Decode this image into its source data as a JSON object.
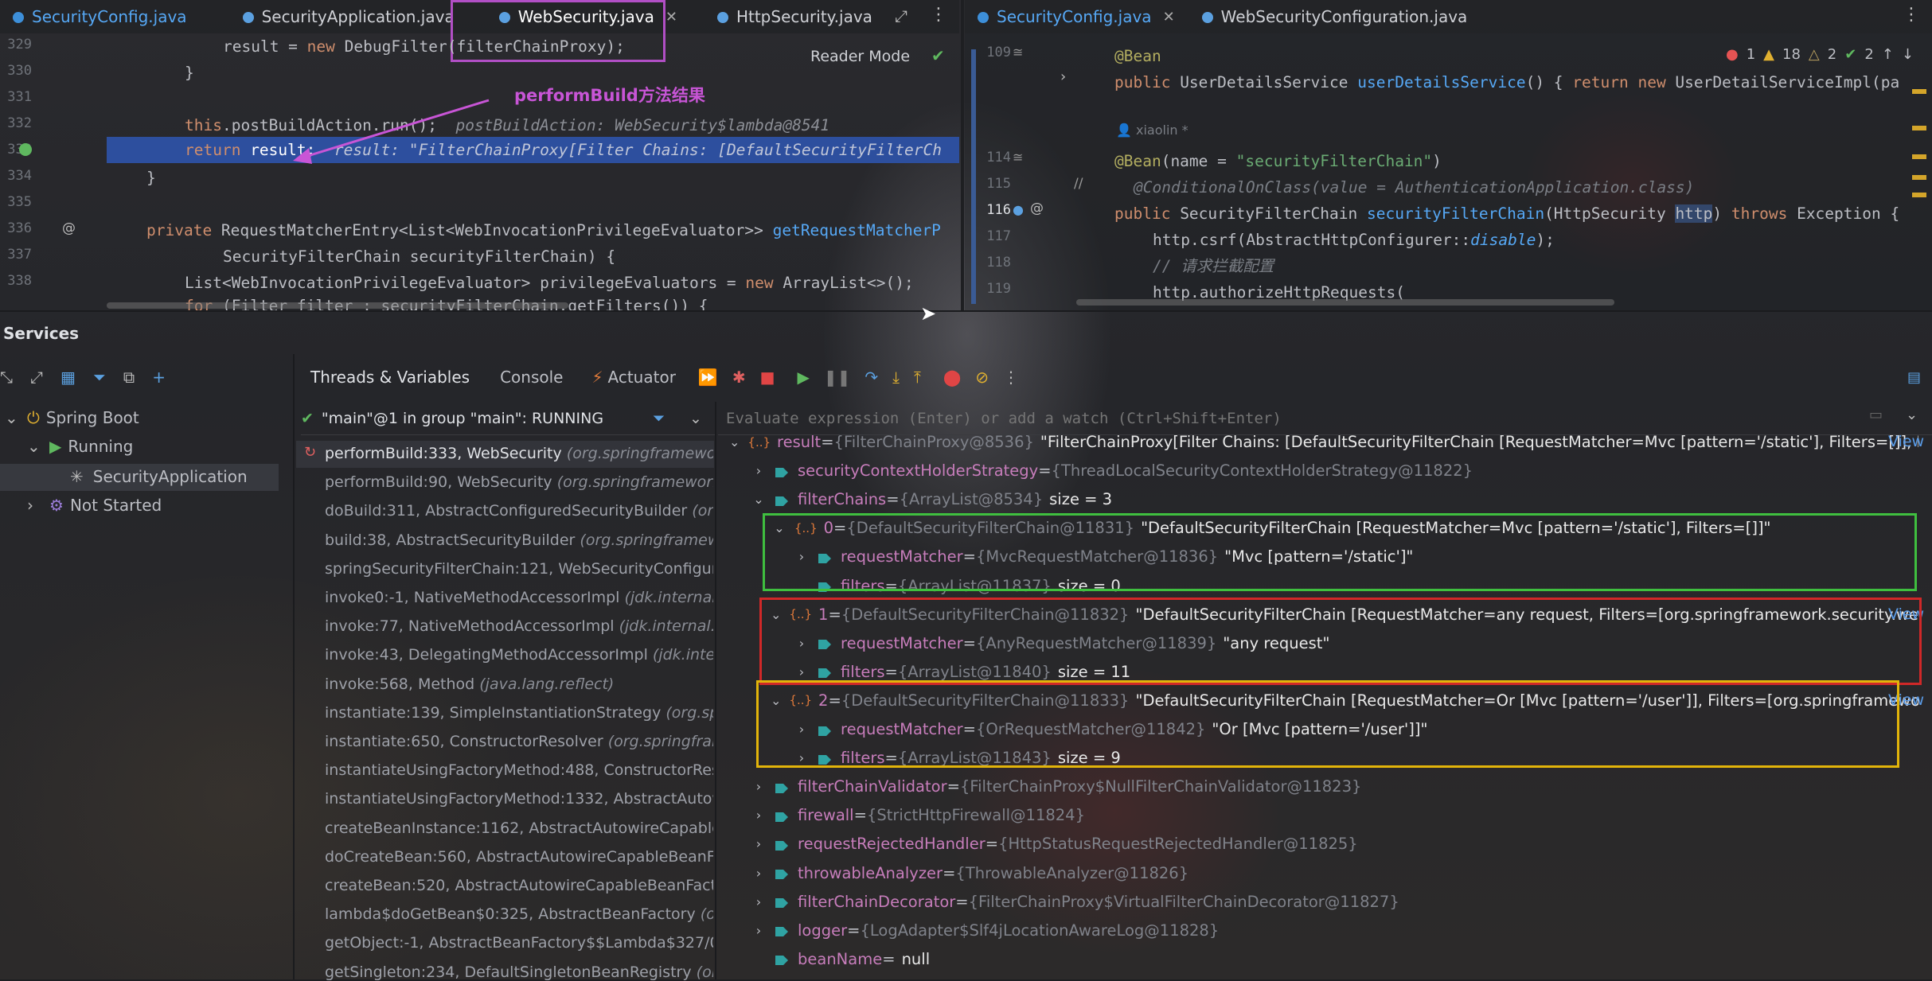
{
  "tabs_left": [
    {
      "label": "SecurityConfig.java",
      "color": "#56a8f5"
    },
    {
      "label": "SecurityApplication.java",
      "color": "#cfd1d6"
    },
    {
      "label": "WebSecurity.java",
      "color": "#ffffff"
    },
    {
      "label": "HttpSecurity.java",
      "color": "#cfd1d6"
    }
  ],
  "tabs_right": [
    {
      "label": "SecurityConfig.java",
      "color": "#56a8f5"
    },
    {
      "label": "WebSecurityConfiguration.java",
      "color": "#cfd1d6"
    }
  ],
  "editor_left": {
    "reader_mode": "Reader Mode",
    "annotation": "performBuild方法结果",
    "line_numbers": [
      "329",
      "330",
      "331",
      "332",
      "333",
      "334",
      "335",
      "336",
      "337",
      "338"
    ],
    "lines": {
      "l329a": "result = ",
      "l329b": "new ",
      "l329c": "DebugFilter(filterChainProxy);",
      "l330": "}",
      "l332a": "this",
      "l332b": ".postBuildAction.run();",
      "l332h": "postBuildAction: WebSecurity$lambda@8541",
      "l333a": "return ",
      "l333b": "result;",
      "l333h": "result: \"FilterChainProxy[Filter Chains: [DefaultSecurityFilterCh",
      "l334": "}",
      "l336a": "private ",
      "l336b": "RequestMatcherEntry<List<WebInvocationPrivilegeEvaluator>> ",
      "l336c": "getRequestMatcherP",
      "l337": "SecurityFilterChain securityFilterChain) {",
      "l338a": "List<WebInvocationPrivilegeEvaluator> privilegeEvaluators = ",
      "l338b": "new ",
      "l338c": "ArrayList<>();",
      "l339a": "for ",
      "l339b": "(Filter filter : securityFilterChain.getFilters()) {"
    }
  },
  "editor_right": {
    "line_numbers": [
      "109",
      "",
      "114",
      "115",
      "116",
      "117",
      "118",
      "119"
    ],
    "inspections": {
      "errors": "1",
      "warnings": "18",
      "weak": "2",
      "ok": "2"
    },
    "lines": {
      "r1": "@Bean",
      "r2a": "public ",
      "r2b": "UserDetailsService ",
      "r2c": "userDetailsService",
      "r2d": "() { ",
      "r2e": "return new ",
      "r2f": "UserDetailServiceImpl(pa",
      "author": "xiaolin *",
      "r3a": "@Bean",
      "r3b": "(name = ",
      "r3c": "\"securityFilterChain\"",
      "r3d": ")",
      "r4a": "//",
      "r4b": "@ConditionalOnClass(value = AuthenticationApplication.class)",
      "r5a": "public ",
      "r5b": "SecurityFilterChain ",
      "r5c": "securityFilterChain",
      "r5d": "(HttpSecurity ",
      "r5e": "http",
      "r5f": ") ",
      "r5g": "throws ",
      "r5h": "Exception {",
      "r6a": "http.csrf(AbstractHttpConfigurer::",
      "r6b": "disable",
      "r6c": ");",
      "r7": "// 请求拦截配置",
      "r8": "http.authorizeHttpRequests("
    }
  },
  "services": {
    "title": "Services",
    "tree": [
      {
        "label": "Spring Boot",
        "level": 0
      },
      {
        "label": "Running",
        "level": 1
      },
      {
        "label": "SecurityApplication",
        "level": 2
      },
      {
        "label": "Not Started",
        "level": 1
      }
    ]
  },
  "debugger": {
    "tabs": [
      "Threads & Variables",
      "Console",
      "Actuator"
    ],
    "thread": "\"main\"@1 in group \"main\": RUNNING",
    "eval_placeholder": "Evaluate expression (Enter) or add a watch (Ctrl+Shift+Enter)",
    "frames": [
      {
        "m": "performBuild:333, WebSecurity ",
        "p": "(org.springframework"
      },
      {
        "m": "performBuild:90, WebSecurity ",
        "p": "(org.springframework."
      },
      {
        "m": "doBuild:311, AbstractConfiguredSecurityBuilder ",
        "p": "(org.s"
      },
      {
        "m": "build:38, AbstractSecurityBuilder ",
        "p": "(org.springframewo"
      },
      {
        "m": "springSecurityFilterChain:121, WebSecurityConfigura",
        "p": ""
      },
      {
        "m": "invoke0:-1, NativeMethodAccessorImpl ",
        "p": "(jdk.internal.r"
      },
      {
        "m": "invoke:77, NativeMethodAccessorImpl ",
        "p": "(jdk.internal.re"
      },
      {
        "m": "invoke:43, DelegatingMethodAccessorImpl ",
        "p": "(jdk.intern"
      },
      {
        "m": "invoke:568, Method ",
        "p": "(java.lang.reflect)"
      },
      {
        "m": "instantiate:139, SimpleInstantiationStrategy ",
        "p": "(org.sprin"
      },
      {
        "m": "instantiate:650, ConstructorResolver ",
        "p": "(org.springfram"
      },
      {
        "m": "instantiateUsingFactoryMethod:488, ConstructorReso",
        "p": ""
      },
      {
        "m": "instantiateUsingFactoryMethod:1332, AbstractAutow",
        "p": ""
      },
      {
        "m": "createBeanInstance:1162, AbstractAutowireCapableBe",
        "p": ""
      },
      {
        "m": "doCreateBean:560, AbstractAutowireCapableBeanFac",
        "p": ""
      },
      {
        "m": "createBean:520, AbstractAutowireCapableBeanFacto",
        "p": ""
      },
      {
        "m": "lambda$doGetBean$0:325, AbstractBeanFactory ",
        "p": "(org"
      },
      {
        "m": "getObject:-1, AbstractBeanFactory$$Lambda$327/0x",
        "p": ""
      },
      {
        "m": "getSingleton:234, DefaultSingletonBeanRegistry ",
        "p": "(org"
      }
    ],
    "vars": [
      {
        "k": "result",
        "n": "result",
        "t": "{FilterChainProxy@8536}",
        "v": "\"FilterChainProxy[Filter Chains: [DefaultSecurityFilterChain [RequestMatcher=Mvc [pattern='/static'], Filters=[]], Defa...",
        "view": "View"
      },
      {
        "k": "sc",
        "n": "securityContextHolderStrategy",
        "t": "{ThreadLocalSecurityContextHolderStrategy@11822}",
        "v": ""
      },
      {
        "k": "fc",
        "n": "filterChains",
        "t": "{ArrayList@8534}",
        "v": "size = 3"
      },
      {
        "k": "c0",
        "n": "0",
        "t": "{DefaultSecurityFilterChain@11831}",
        "v": "\"DefaultSecurityFilterChain [RequestMatcher=Mvc [pattern='/static'], Filters=[]]\""
      },
      {
        "k": "c0m",
        "n": "requestMatcher",
        "t": "{MvcRequestMatcher@11836}",
        "v": "\"Mvc [pattern='/static']\""
      },
      {
        "k": "c0f",
        "n": "filters",
        "t": "{ArrayList@11837}",
        "v": "size = 0"
      },
      {
        "k": "c1",
        "n": "1",
        "t": "{DefaultSecurityFilterChain@11832}",
        "v": "\"DefaultSecurityFilterChain [RequestMatcher=any request, Filters=[org.springframework.security.web.se...",
        "view": "View"
      },
      {
        "k": "c1m",
        "n": "requestMatcher",
        "t": "{AnyRequestMatcher@11839}",
        "v": "\"any request\""
      },
      {
        "k": "c1f",
        "n": "filters",
        "t": "{ArrayList@11840}",
        "v": "size = 11"
      },
      {
        "k": "c2",
        "n": "2",
        "t": "{DefaultSecurityFilterChain@11833}",
        "v": "\"DefaultSecurityFilterChain [RequestMatcher=Or [Mvc [pattern='/user']], Filters=[org.springframework.security.we...",
        "view": "View"
      },
      {
        "k": "c2m",
        "n": "requestMatcher",
        "t": "{OrRequestMatcher@11842}",
        "v": "\"Or [Mvc [pattern='/user']]\""
      },
      {
        "k": "c2f",
        "n": "filters",
        "t": "{ArrayList@11843}",
        "v": "size = 9"
      },
      {
        "k": "fv",
        "n": "filterChainValidator",
        "t": "{FilterChainProxy$NullFilterChainValidator@11823}",
        "v": ""
      },
      {
        "k": "fw",
        "n": "firewall",
        "t": "{StrictHttpFirewall@11824}",
        "v": ""
      },
      {
        "k": "rr",
        "n": "requestRejectedHandler",
        "t": "{HttpStatusRequestRejectedHandler@11825}",
        "v": ""
      },
      {
        "k": "ta",
        "n": "throwableAnalyzer",
        "t": "{ThrowableAnalyzer@11826}",
        "v": ""
      },
      {
        "k": "fd",
        "n": "filterChainDecorator",
        "t": "{FilterChainProxy$VirtualFilterChainDecorator@11827}",
        "v": ""
      },
      {
        "k": "lg",
        "n": "logger",
        "t": "{LogAdapter$Slf4jLocationAwareLog@11828}",
        "v": ""
      },
      {
        "k": "bn",
        "n": "beanName",
        "t": "",
        "v": "null"
      }
    ]
  },
  "colors": {
    "green_box": "#3fbf3f",
    "red_box": "#d02828",
    "yellow_box": "#e2b40a",
    "purple_box": "#b14fc5"
  }
}
